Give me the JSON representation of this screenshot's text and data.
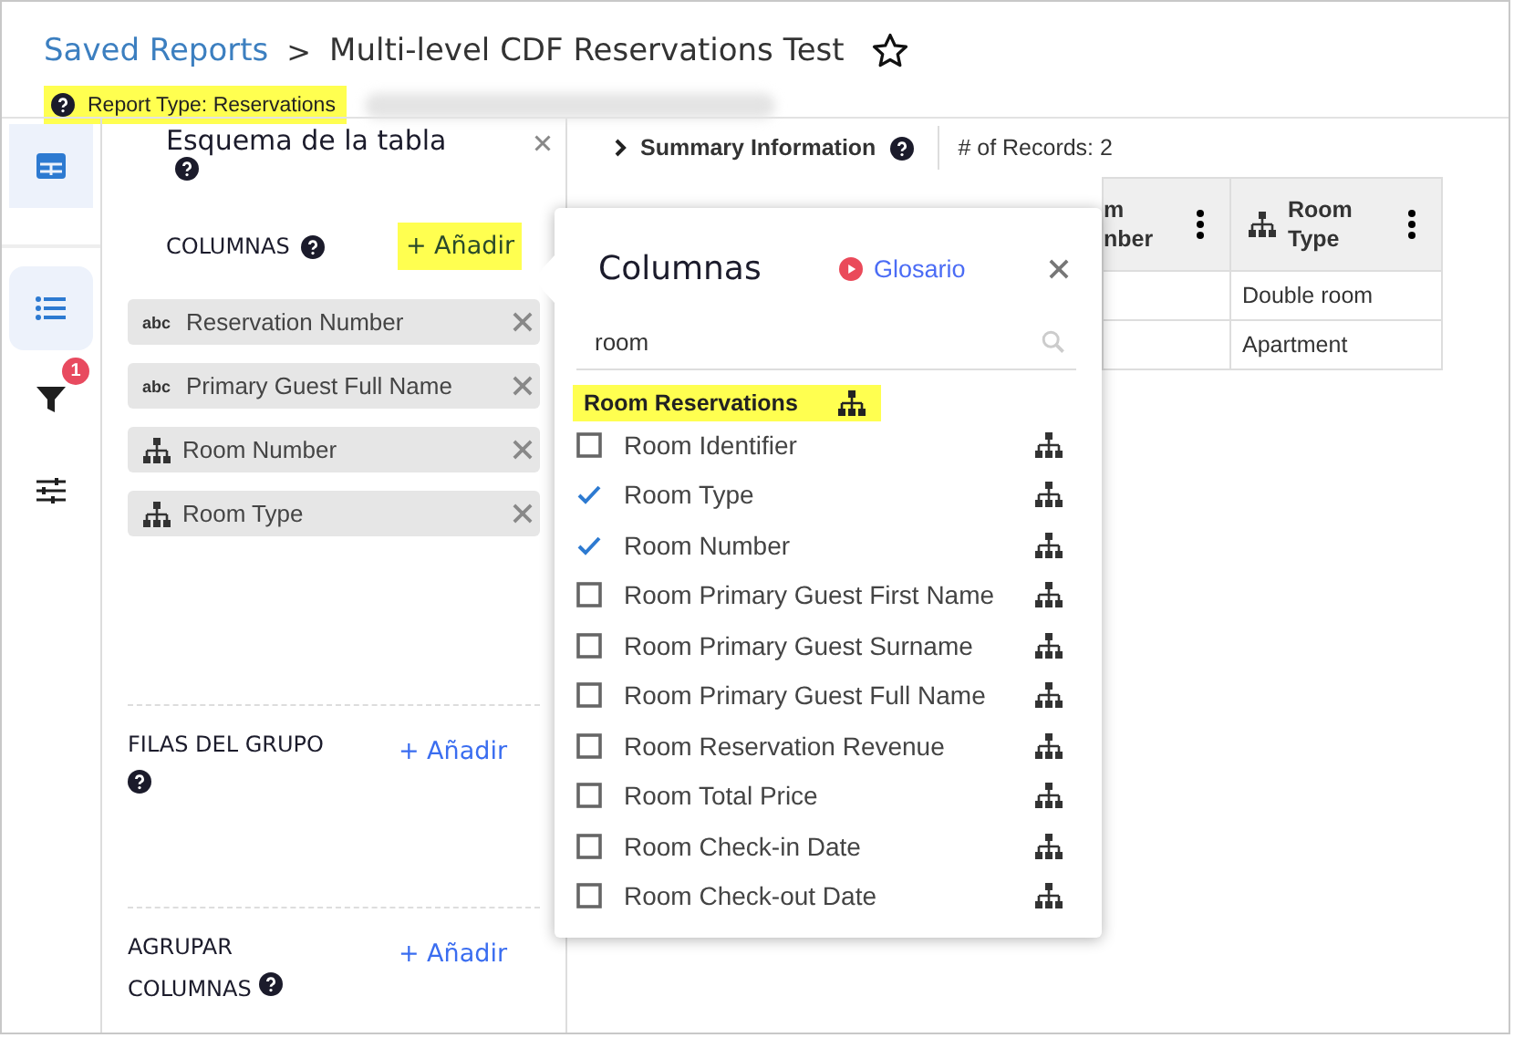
{
  "breadcrumb": {
    "parent": "Saved Reports",
    "separator": ">",
    "title": "Multi-level CDF Reservations Test",
    "favorite": false
  },
  "report_type": "Report Type: Reservations",
  "rail": [
    {
      "selected": true
    },
    {
      "selected": true
    },
    {
      "selected": false,
      "badge": "1"
    },
    {
      "selected": false
    }
  ],
  "schema_panel": {
    "title": "Esquema de la tabla",
    "sections": [
      {
        "label": "COLUMNAS",
        "add": "+ Añadir",
        "highlighted": true,
        "chips": [
          {
            "kind": "text",
            "icon_text": "abc",
            "label": "Reservation Number"
          },
          {
            "kind": "text",
            "icon_text": "abc",
            "label": "Primary Guest Full Name"
          },
          {
            "kind": "hierarchy",
            "label": "Room Number"
          },
          {
            "kind": "hierarchy",
            "label": "Room Type"
          }
        ]
      },
      {
        "label": "FILAS DEL GRUPO",
        "add": "+ Añadir",
        "highlighted": false
      },
      {
        "label": "AGRUPAR COLUMNAS",
        "add": "+ Añadir",
        "highlighted": false
      }
    ]
  },
  "summary": {
    "label": "Summary Information",
    "records": "# of Records: 2"
  },
  "table": {
    "columns": [
      "m\nnber",
      "Room\nType"
    ],
    "rows": [
      [
        "",
        "Double room"
      ],
      [
        "",
        "Apartment"
      ]
    ]
  },
  "popover": {
    "title": "Columnas",
    "glossary": "Glosario",
    "search": {
      "value": "room"
    },
    "group": {
      "label": "Room Reservations",
      "highlighted": true
    },
    "items": [
      {
        "label": "Room Identifier",
        "checked": false
      },
      {
        "label": "Room Type",
        "checked": true
      },
      {
        "label": "Room Number",
        "checked": true
      },
      {
        "label": "Room Primary Guest First Name",
        "checked": false
      },
      {
        "label": "Room Primary Guest Surname",
        "checked": false
      },
      {
        "label": "Room Primary Guest Full Name",
        "checked": false
      },
      {
        "label": "Room Reservation Revenue",
        "checked": false
      },
      {
        "label": "Room Total Price",
        "checked": false
      },
      {
        "label": "Room Check-in Date",
        "checked": false
      },
      {
        "label": "Room Check-out Date",
        "checked": false
      }
    ]
  }
}
